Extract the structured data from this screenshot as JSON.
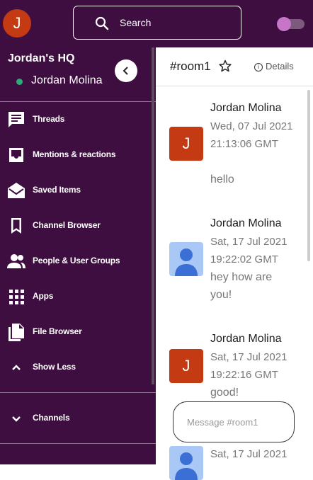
{
  "header": {
    "avatar_initial": "J",
    "search_placeholder": "Search",
    "theme_toggle": "on"
  },
  "sidebar": {
    "workspace_name": "Jordan's HQ",
    "user_name": "Jordan Molina",
    "user_status_color": "#2bac76",
    "items": [
      {
        "label": "Threads",
        "icon": "threads-icon"
      },
      {
        "label": "Mentions & reactions",
        "icon": "inbox-icon"
      },
      {
        "label": "Saved Items",
        "icon": "mail-open-icon"
      },
      {
        "label": "Channel Browser",
        "icon": "bookmark-icon"
      },
      {
        "label": "People & User Groups",
        "icon": "people-icon"
      },
      {
        "label": "Apps",
        "icon": "apps-grid-icon"
      },
      {
        "label": "File Browser",
        "icon": "files-icon"
      },
      {
        "label": "Show Less",
        "icon": "chevron-up-icon"
      }
    ],
    "channels_label": "Channels"
  },
  "room": {
    "name": "#room1",
    "details_label": "Details",
    "composer_placeholder": "Message #room1"
  },
  "messages": [
    {
      "author": "Jordan Molina",
      "timestamp": " Wed, 07 Jul 2021 21:13:06 GMT",
      "text": "hello",
      "avatar": "J"
    },
    {
      "author": "Jordan Molina",
      "timestamp": " Sat, 17 Jul 2021 19:22:02 GMT",
      "text": "hey how are you!",
      "avatar": ""
    },
    {
      "author": "Jordan Molina",
      "timestamp": " Sat, 17 Jul 2021 19:22:16 GMT",
      "text": "good!",
      "avatar": "J"
    },
    {
      "author": "",
      "timestamp": " Sat, 17 Jul 2021",
      "text": "",
      "avatar": ""
    }
  ],
  "colors": {
    "sidebar_bg": "#3f0e40",
    "avatar_bg": "#c43a13",
    "default_avatar_bg": "#a9c8f5",
    "toggle_knob": "#c676c6"
  }
}
